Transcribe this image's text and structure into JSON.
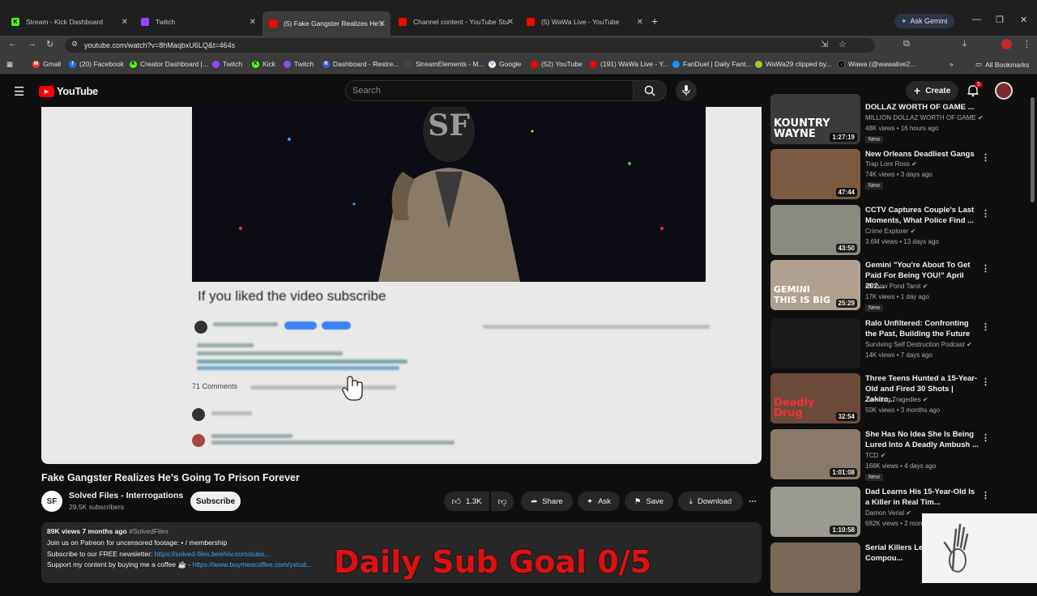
{
  "browser": {
    "tabs": [
      {
        "title": "Stream - Kick Dashboard",
        "fav": "K",
        "color": "#53fc18"
      },
      {
        "title": "Twitch",
        "fav": "",
        "color": "#9146ff"
      },
      {
        "title": "(5) Fake Gangster Realizes He's",
        "fav": "",
        "color": "#ff0000"
      },
      {
        "title": "Channel content - YouTube Stu",
        "fav": "",
        "color": "#ff0000"
      },
      {
        "title": "(5) WaWa Live - YouTube",
        "fav": "",
        "color": "#ff0000"
      }
    ],
    "new_tab": "+",
    "gemini": "Ask Gemini",
    "url": "youtube.com/watch?v=8hMaqbxU6LQ&t=464s",
    "bookmarks": [
      "Gmail",
      "(20) Facebook",
      "Creator Dashboard |...",
      "Twitch",
      "Kick",
      "Twitch",
      "Dashboard - Restre...",
      "StreamElements - M...",
      "Google",
      "(52) YouTube",
      "(191) WaWa Live - Y...",
      "FanDuel | Daily Fant...",
      "WaWa29 clipped by...",
      "Wawa (@wawalive2..."
    ],
    "all_bookmarks": "All Bookmarks"
  },
  "youtube": {
    "logo": "YouTube",
    "search_placeholder": "Search",
    "create": "Create",
    "notif_count": "5"
  },
  "video": {
    "overlay_text": "If you liked the video subscribe",
    "blur_comments": "71 Comments",
    "title": "Fake Gangster Realizes He’s Going To Prison Forever",
    "channel": "Solved Files - Interrogations",
    "channel_initials": "SF",
    "subscribers": "29.5K subscribers",
    "subscribe": "Subscribe",
    "likes": "1.3K",
    "share": "Share",
    "ask": "Ask",
    "save": "Save",
    "download": "Download",
    "desc_meta": "89K views  7 months ago",
    "desc_tag": "#SolvedFiles",
    "desc_line1": "Join us on Patreon for uncensored footage: • / membership",
    "desc_line2_text": "Subscribe to our FREE newsletter: ",
    "desc_line2_link": "https://solved-files.beehiiv.com/subs...",
    "desc_line3_text": "Support my content by buying me a coffee ☕ - ",
    "desc_line3_link": "https://www.buymeacoffee.com/ystud..."
  },
  "overlay_goal": "Daily Sub Goal 0/5",
  "recommendations": [
    {
      "title": "DOLLAZ WORTH OF GAME ...",
      "channel": "MILLION DOLLAZ WORTH OF GAME",
      "meta": "48K views • 16 hours ago",
      "badge": "New",
      "duration": "1:27:19",
      "thumb": "KOUNTRY WAYNE",
      "bg": "#3a3a3a"
    },
    {
      "title": "New Orleans Deadliest Gangs",
      "channel": "Trap Lore Ross",
      "meta": "74K views • 3 days ago",
      "badge": "New",
      "duration": "47:44",
      "thumb": "",
      "bg": "#7a5a40"
    },
    {
      "title": "CCTV Captures Couple's Last Moments, What Police Find ...",
      "channel": "Crime Explorer",
      "meta": "3.6M views • 13 days ago",
      "badge": "",
      "duration": "43:50",
      "thumb": "",
      "bg": "#8a8a80"
    },
    {
      "title": "Gemini \"You're About To Get Paid For Being YOU!\" April 202...",
      "channel": "Minnow Pond Tarot",
      "meta": "17K views • 1 day ago",
      "badge": "New",
      "duration": "25:29",
      "thumb": "GEMINI THIS IS BIG",
      "bg": "#b0a090"
    },
    {
      "title": "Ralo Unfiltered: Confronting the Past, Building the Future",
      "channel": "Surviving Self Destruction Podcast",
      "meta": "14K views • 7 days ago",
      "badge": "",
      "duration": "",
      "thumb": "",
      "bg": "#1a1a1a"
    },
    {
      "title": "Three Teens Hunted a 15-Year-Old and Fired 30 Shots | Zakiro...",
      "channel": "Trending Tragedies",
      "meta": "50K views • 3 months ago",
      "badge": "",
      "duration": "32:54",
      "thumb": "Deadly Drug",
      "bg": "#6a4a3a"
    },
    {
      "title": "She Has No Idea She Is Being Lured Into A Deadly Ambush ...",
      "channel": "TCD",
      "meta": "168K views • 4 days ago",
      "badge": "New",
      "duration": "1:01:08",
      "thumb": "",
      "bg": "#8a7a6a"
    },
    {
      "title": "Dad Learns His 15-Year-Old Is a Killer in Real Tim...",
      "channel": "Damon Verial",
      "meta": "682K views • 2 mon...",
      "badge": "",
      "duration": "1:10:58",
      "thumb": "",
      "bg": "#9a9a90"
    },
    {
      "title": "Serial Killers Lea... Murder Compou...",
      "channel": "",
      "meta": "",
      "badge": "",
      "duration": "",
      "thumb": "",
      "bg": "#7a6a5a"
    }
  ]
}
